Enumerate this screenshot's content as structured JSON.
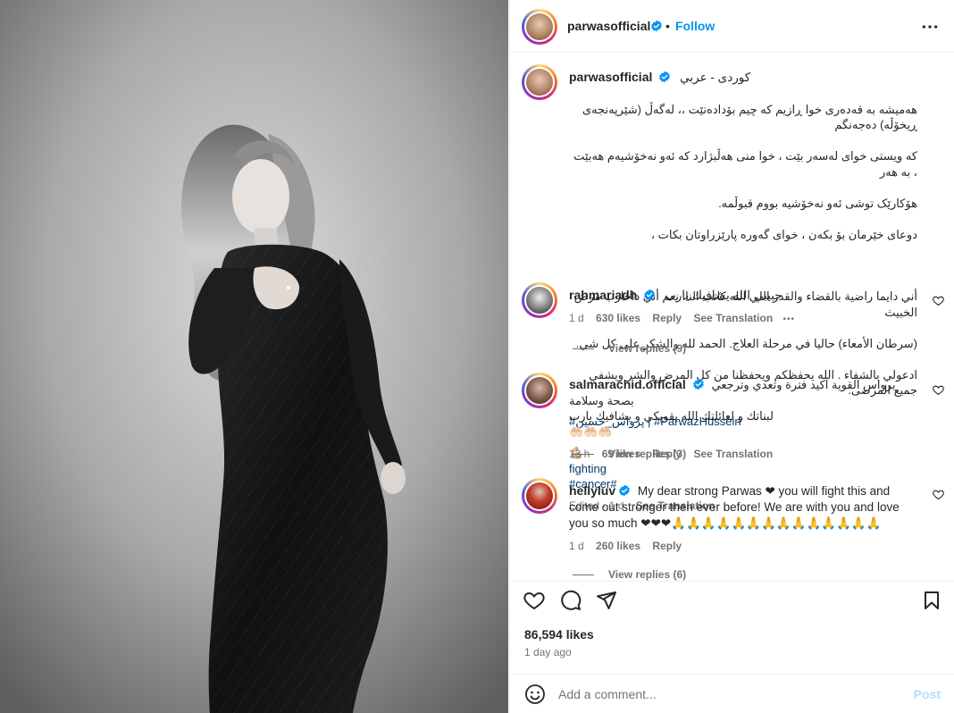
{
  "post": {
    "username": "parwasofficial",
    "follow_label": "Follow",
    "header_dot": "•",
    "more_icon": "more-horizontal-icon"
  },
  "caption": {
    "username": "parwasofficial",
    "kurdish_heading": "کوردی - عربي",
    "kurdish_lines": [
      "هەمیشە بە قەدەری خوا ڕازیم کە چیم بۆدادەنێت ،، لەگەڵ (شێرپەنجەی ڕیخۆڵە) دەجەنگم",
      "کە ویستی خوای لەسەر بێت ، خوا منی هەڵبژارد کە ئەو نەخۆشیەم هەبێت ، بە هەر",
      "هۆکارێک توشی ئەو نەخۆشیە بووم قبوڵمە.",
      "دوعای خێرمان بۆ بکەن ، خوای گەورە پارێزراوتان بکات ،"
    ],
    "arabic_lines": [
      "أني دايما راضية بالقضاء والقدر اللي الله كاتب النا. نعم أني داحارب مرض الخبيث",
      "(سرطان الأمعاء) حاليا في مرحلة العلاج. الحمد لله والشكر على كل شي.",
      "ادعولي بالشفاء . الله يحفظكم ويحفظنا من كل المرض والشر ويشفي جميع المرضى."
    ],
    "hashtag_line": "#پرواس_حسين | #ParwazHussein",
    "fighting_prefix": "💪🏼",
    "fighting_text": "fighting",
    "cancer_tag": "#cancer",
    "cancer_suffix": "#",
    "edited_meta": "Edited · 1 d",
    "see_translation": "See Translation"
  },
  "comments": [
    {
      "username": "rahmariadh",
      "text": "حبيبي الله يشافيك يارب",
      "time": "1 d",
      "likes": "630 likes",
      "reply": "Reply",
      "see_translation": "See Translation",
      "more": "•••",
      "view_replies": "View replies (9)"
    },
    {
      "username": "salmarachid.official",
      "text_line1": "برواس القوية اكيد فترة وتعدي وترجعي بصحة وسلامة",
      "text_line2": "لبناتك و لعائلتك الله يقويكي و يشافيك يارب 🤲🏻🤲🏻🤲🏻",
      "time": "13 h",
      "likes": "69 likes",
      "reply": "Reply",
      "see_translation": "See Translation",
      "view_replies": "View replies (3)"
    },
    {
      "username": "hellyluv",
      "text": "My dear strong Parwas ❤ you will fight this and come out stronger then ever before! We are with you and love you so much ❤❤❤🙏🙏🙏🙏🙏🙏🙏🙏🙏🙏🙏🙏🙏🙏",
      "time": "1 d",
      "likes": "260 likes",
      "reply": "Reply",
      "view_replies": "View replies (6)"
    }
  ],
  "actions": {
    "likes": "86,594 likes",
    "time_ago": "1 day ago"
  },
  "composer": {
    "placeholder": "Add a comment...",
    "post_label": "Post"
  },
  "colors": {
    "accent": "#0095f6",
    "verified": "#0095f6",
    "muted": "#737373",
    "post_disabled": "#b2dffc"
  }
}
